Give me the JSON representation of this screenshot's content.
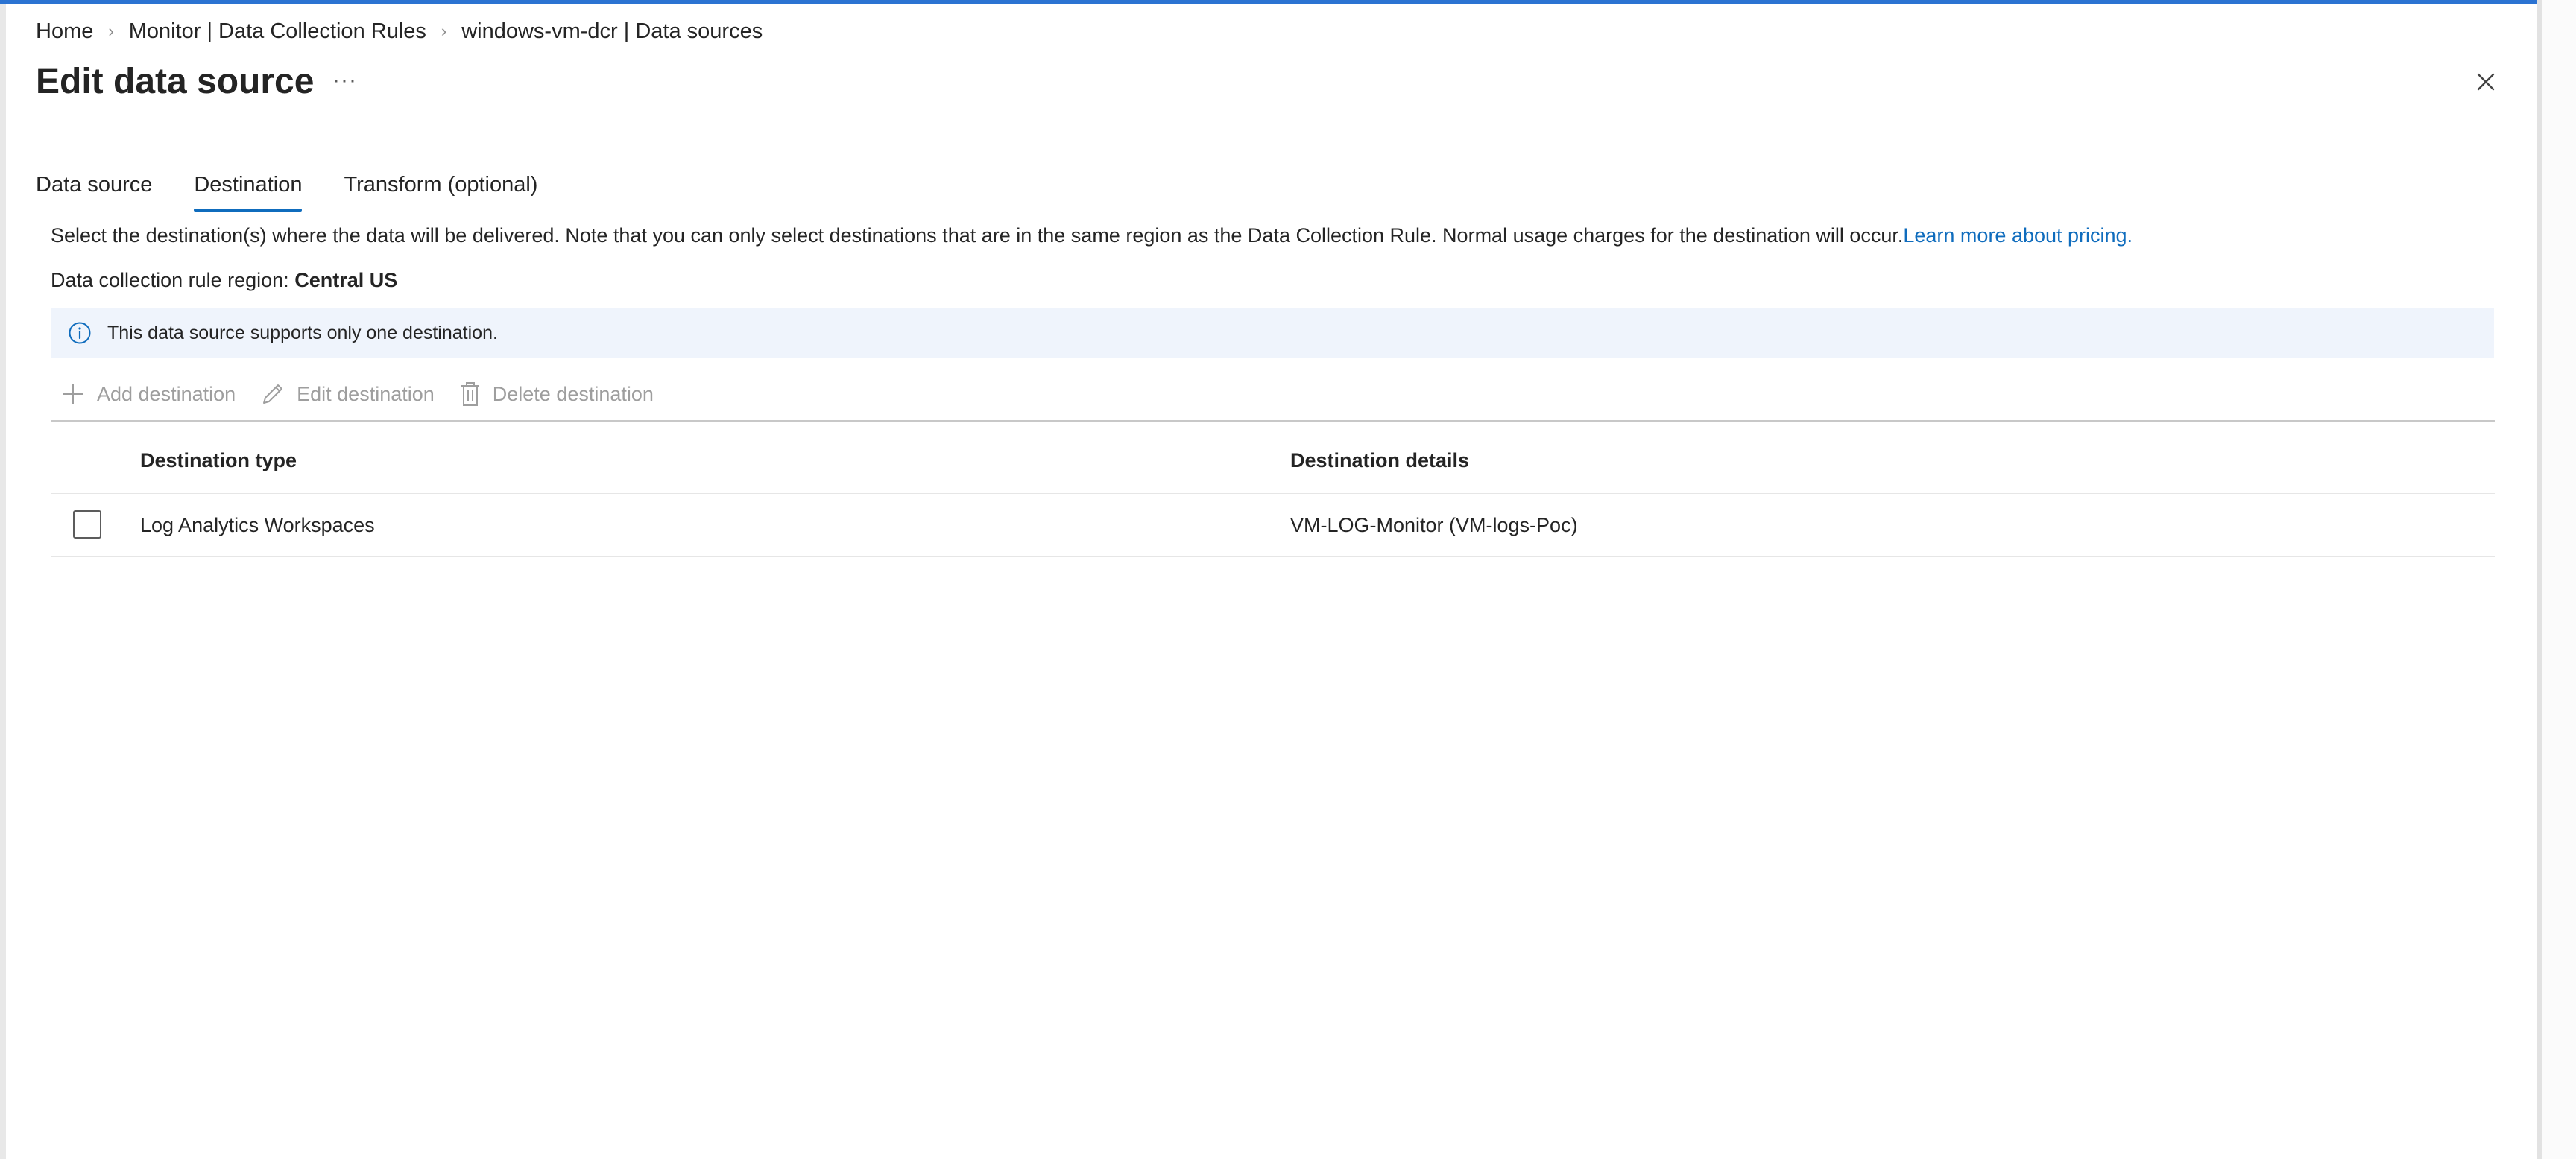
{
  "breadcrumb": {
    "items": [
      "Home",
      "Monitor | Data Collection Rules",
      "windows-vm-dcr | Data sources"
    ],
    "separator": "›"
  },
  "header": {
    "title": "Edit data source",
    "more_label": "···"
  },
  "tabs": [
    {
      "label": "Data source",
      "active": false
    },
    {
      "label": "Destination",
      "active": true
    },
    {
      "label": "Transform (optional)",
      "active": false
    }
  ],
  "description": {
    "text": "Select the destination(s) where the data will be delivered. Note that you can only select destinations that are in the same region as the Data Collection Rule. Normal usage charges for the destination will occur.",
    "link": "Learn more about pricing."
  },
  "region": {
    "label": "Data collection rule region:",
    "value": "Central US"
  },
  "info_banner": {
    "text": "This data source supports only one destination."
  },
  "toolbar": {
    "add_label": "Add destination",
    "edit_label": "Edit destination",
    "delete_label": "Delete destination"
  },
  "table": {
    "columns": [
      "Destination type",
      "Destination details"
    ],
    "rows": [
      {
        "type": "Log Analytics Workspaces",
        "details": "VM-LOG-Monitor (VM-logs-Poc)",
        "checked": false
      }
    ]
  },
  "colors": {
    "accent": "#0f6cbd",
    "top_bar": "#2b73d2",
    "banner_bg": "#eff4fc",
    "disabled_text": "#9e9e9e"
  }
}
